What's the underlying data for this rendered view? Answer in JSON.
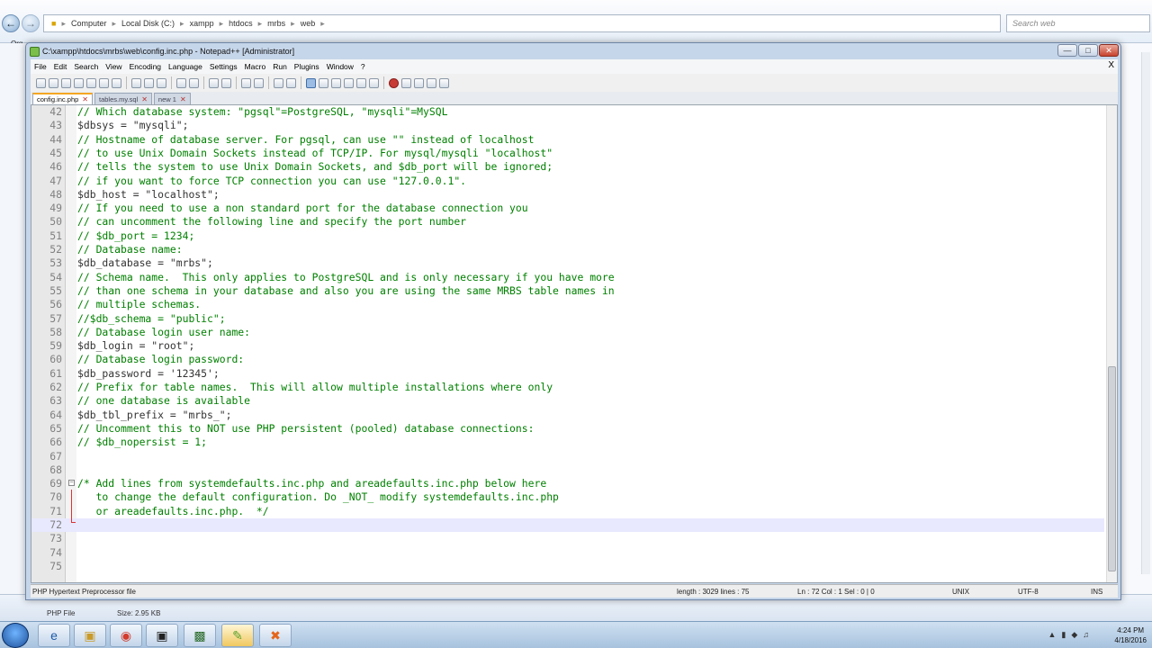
{
  "explorer": {
    "breadcrumb": [
      "Computer",
      "Local Disk (C:)",
      "xampp",
      "htdocs",
      "mrbs",
      "web"
    ],
    "search_placeholder": "Search web",
    "organize_label": "Org",
    "details": {
      "type": "PHP File",
      "size": "Size: 2.95 KB"
    }
  },
  "window": {
    "title": "C:\\xampp\\htdocs\\mrbs\\web\\config.inc.php - Notepad++ [Administrator]",
    "menu": [
      "File",
      "Edit",
      "Search",
      "View",
      "Encoding",
      "Language",
      "Settings",
      "Macro",
      "Run",
      "Plugins",
      "Window",
      "?"
    ],
    "close_x": "X",
    "tabs": [
      {
        "label": "config.inc.php",
        "active": true
      },
      {
        "label": "tables.my.sql",
        "active": false
      },
      {
        "label": "new 1",
        "active": false
      }
    ]
  },
  "code_lines": [
    {
      "n": "42",
      "text": "// Which database system: \"pgsql\"=PostgreSQL, \"mysqli\"=MySQL",
      "comment": true
    },
    {
      "n": "43",
      "text": "$dbsys = \"mysqli\";",
      "comment": false
    },
    {
      "n": "44",
      "text": "// Hostname of database server. For pgsql, can use \"\" instead of localhost",
      "comment": true
    },
    {
      "n": "45",
      "text": "// to use Unix Domain Sockets instead of TCP/IP. For mysql/mysqli \"localhost\"",
      "comment": true
    },
    {
      "n": "46",
      "text": "// tells the system to use Unix Domain Sockets, and $db_port will be ignored;",
      "comment": true
    },
    {
      "n": "47",
      "text": "// if you want to force TCP connection you can use \"127.0.0.1\".",
      "comment": true
    },
    {
      "n": "48",
      "text": "$db_host = \"localhost\";",
      "comment": false
    },
    {
      "n": "49",
      "text": "// If you need to use a non standard port for the database connection you",
      "comment": true
    },
    {
      "n": "50",
      "text": "// can uncomment the following line and specify the port number",
      "comment": true
    },
    {
      "n": "51",
      "text": "// $db_port = 1234;",
      "comment": true
    },
    {
      "n": "52",
      "text": "// Database name:",
      "comment": true
    },
    {
      "n": "53",
      "text": "$db_database = \"mrbs\";",
      "comment": false
    },
    {
      "n": "54",
      "text": "// Schema name.  This only applies to PostgreSQL and is only necessary if you have more",
      "comment": true
    },
    {
      "n": "55",
      "text": "// than one schema in your database and also you are using the same MRBS table names in",
      "comment": true
    },
    {
      "n": "56",
      "text": "// multiple schemas.",
      "comment": true
    },
    {
      "n": "57",
      "text": "//$db_schema = \"public\";",
      "comment": true
    },
    {
      "n": "58",
      "text": "// Database login user name:",
      "comment": true
    },
    {
      "n": "59",
      "text": "$db_login = \"root\";",
      "comment": false
    },
    {
      "n": "60",
      "text": "// Database login password:",
      "comment": true
    },
    {
      "n": "61",
      "text": "$db_password = '12345';",
      "comment": false
    },
    {
      "n": "62",
      "text": "// Prefix for table names.  This will allow multiple installations where only",
      "comment": true
    },
    {
      "n": "63",
      "text": "// one database is available",
      "comment": true
    },
    {
      "n": "64",
      "text": "$db_tbl_prefix = \"mrbs_\";",
      "comment": false
    },
    {
      "n": "65",
      "text": "// Uncomment this to NOT use PHP persistent (pooled) database connections:",
      "comment": true
    },
    {
      "n": "66",
      "text": "// $db_nopersist = 1;",
      "comment": true
    },
    {
      "n": "67",
      "text": "",
      "comment": false
    },
    {
      "n": "68",
      "text": "",
      "comment": false
    },
    {
      "n": "69",
      "text": "/* Add lines from systemdefaults.inc.php and areadefaults.inc.php below here",
      "comment": true
    },
    {
      "n": "70",
      "text": "   to change the default configuration. Do _NOT_ modify systemdefaults.inc.php",
      "comment": true
    },
    {
      "n": "71",
      "text": "   or areadefaults.inc.php.  */",
      "comment": true
    },
    {
      "n": "72",
      "text": "",
      "comment": false,
      "current": true
    },
    {
      "n": "73",
      "text": "",
      "comment": false
    },
    {
      "n": "74",
      "text": "",
      "comment": false
    },
    {
      "n": "75",
      "text": "",
      "comment": false
    }
  ],
  "statusbar": {
    "filetype": "PHP Hypertext Preprocessor file",
    "length": "length : 3029    lines : 75",
    "position": "Ln : 72    Col : 1    Sel : 0 | 0",
    "eol": "UNIX",
    "encoding": "UTF-8",
    "mode": "INS"
  },
  "taskbar": {
    "time": "4:24 PM",
    "date": "4/18/2016"
  }
}
